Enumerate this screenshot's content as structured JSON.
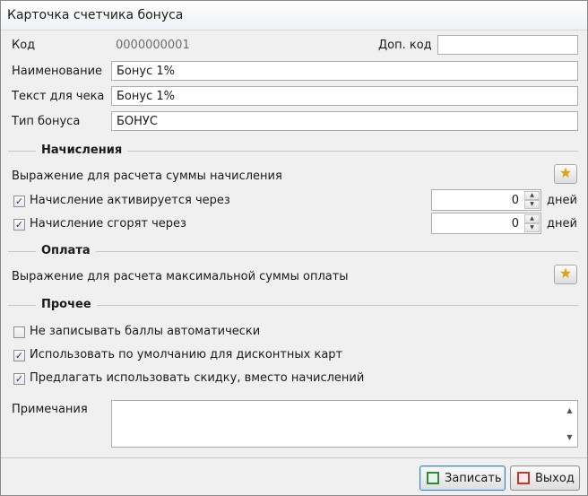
{
  "window": {
    "title": "Карточка счетчика бонуса"
  },
  "fields": {
    "code_label": "Код",
    "code_value": "0000000001",
    "extra_code_label": "Доп. код",
    "extra_code_value": "",
    "name_label": "Наименование",
    "name_value": "Бонус 1%",
    "receipt_label": "Текст для чека",
    "receipt_value": "Бонус 1%",
    "type_label": "Тип бонуса",
    "type_value": "БОНУС"
  },
  "accrual": {
    "section_title": "Начисления",
    "expression_label": "Выражение для расчета суммы начисления",
    "activate": {
      "checked": true,
      "label": "Начисление активируется через",
      "value": "0",
      "unit": "дней"
    },
    "expire": {
      "checked": true,
      "label": "Начисление сгорят  через",
      "value": "0",
      "unit": "дней"
    }
  },
  "payment": {
    "section_title": "Оплата",
    "expression_label": "Выражение для расчета максимальной суммы оплаты"
  },
  "other": {
    "section_title": "Прочее",
    "options": [
      {
        "checked": false,
        "label": "Не записывать баллы автоматически"
      },
      {
        "checked": true,
        "label": "Использовать по умолчанию для дисконтных карт"
      },
      {
        "checked": true,
        "label": "Предлагать использовать скидку, вместо начислений"
      }
    ],
    "notes_label": "Примечания",
    "notes_value": ""
  },
  "icons": {
    "star": "star-icon",
    "save": "save-icon",
    "exit": "exit-icon",
    "accent_star": "#e0a010"
  },
  "footer": {
    "save_label": "Записать",
    "exit_label": "Выход"
  }
}
